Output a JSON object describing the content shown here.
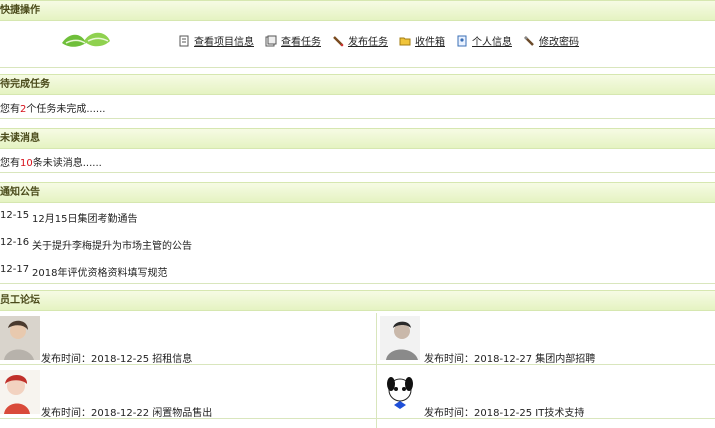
{
  "shortcuts": {
    "title": "快捷操作",
    "links": [
      {
        "label": "查看项目信息",
        "icon": "document-icon"
      },
      {
        "label": "查看任务",
        "icon": "tasks-icon"
      },
      {
        "label": "发布任务",
        "icon": "pen-icon"
      },
      {
        "label": "收件箱",
        "icon": "folder-icon"
      },
      {
        "label": "个人信息",
        "icon": "id-card-icon"
      },
      {
        "label": "修改密码",
        "icon": "key-icon"
      }
    ]
  },
  "pending": {
    "title": "待完成任务",
    "prefix": "您有",
    "count": "2",
    "suffix": "个任务未完成......"
  },
  "unread": {
    "title": "未读消息",
    "prefix": "您有",
    "count": "10",
    "suffix": "条未读消息......"
  },
  "notices": {
    "title": "通知公告",
    "items": [
      {
        "date": "12-15",
        "title": "12月15日集团考勤通告"
      },
      {
        "date": "12-16",
        "title": "关于提升李梅提升为市场主管的公告"
      },
      {
        "date": "12-17",
        "title": "2018年评优资格资料填写规范"
      }
    ]
  },
  "forum": {
    "title": "员工论坛",
    "posts": [
      {
        "text": "发布时间：2018-12-25 招租信息"
      },
      {
        "text": "发布时间：2018-12-27 集团内部招聘"
      },
      {
        "text": "发布时间：2018-12-22 闲置物品售出"
      },
      {
        "text": "发布时间：2018-12-25 IT技术支持"
      }
    ]
  },
  "colors": {
    "accent": "#d6101a",
    "header_bg": "#e5f3c2",
    "border": "#d9e6bd"
  }
}
